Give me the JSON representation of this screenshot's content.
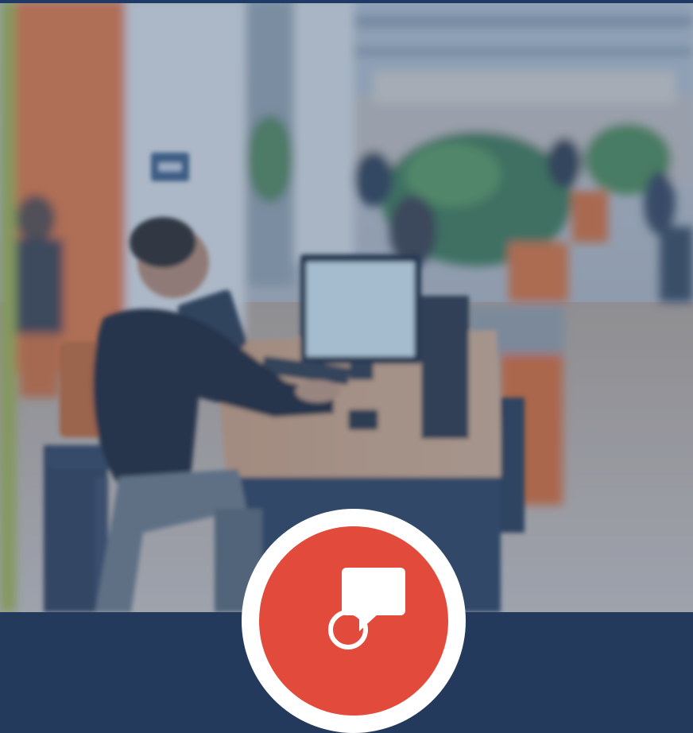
{
  "hero": {
    "photo": "blurred-office-workspace",
    "icon": "chat-bubbles-icon"
  },
  "colors": {
    "header_bar": "#1f3a66",
    "badge_ring": "#ffffff",
    "badge_fill": "#e24a3b",
    "orange_accent": "#e8773f",
    "photo_tint": "#4a6b93"
  }
}
